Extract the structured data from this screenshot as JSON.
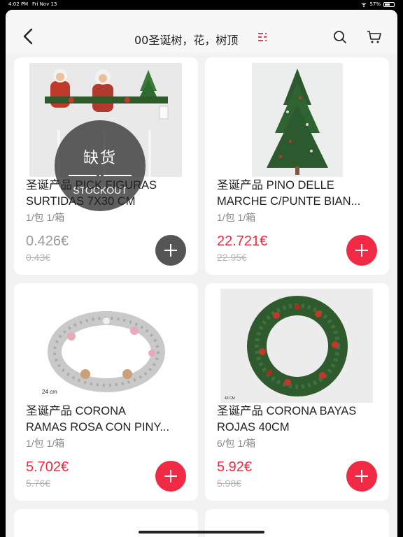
{
  "status_bar": {
    "time": "4:02 PM",
    "date": "Fri Nov 13",
    "battery": "57%",
    "battery_level": 0.57
  },
  "nav": {
    "title": "00圣诞树，花，树顶",
    "back_icon": "chevron-left-icon",
    "menu_icon": "list-icon",
    "search_icon": "search-icon",
    "cart_icon": "cart-icon"
  },
  "colors": {
    "accent": "#f02945",
    "disabled": "#555555",
    "old_price": "#b5b5b5"
  },
  "products": [
    {
      "title_line1": "圣诞产品 PICK FIGURAS",
      "title_line2": "SURTIDAS 7X30 CM",
      "pack": "1/包 1/箱",
      "price": "0.426€",
      "old_price": "0.43€",
      "stockout": true,
      "stockout_cn": "缺货",
      "stockout_en": "STOCKOUT"
    },
    {
      "title_line1": "圣诞产品 PINO DELLE",
      "title_line2": "MARCHE C/PUNTE BIAN...",
      "pack": "1/包 1/箱",
      "price": "22.721€",
      "old_price": "22.95€",
      "stockout": false
    },
    {
      "title_line1": "圣诞产品 CORONA",
      "title_line2": "RAMAS ROSA CON PINY...",
      "pack": "1/包 1/箱",
      "price": "5.702€",
      "old_price": "5.76€",
      "stockout": false,
      "image_caption": "24 cm"
    },
    {
      "title_line1": "圣诞产品 CORONA BAYAS",
      "title_line2": "ROJAS 40CM",
      "pack": "6/包 1/箱",
      "price": "5.92€",
      "old_price": "5.98€",
      "stockout": false,
      "image_caption": "40 CM"
    }
  ]
}
